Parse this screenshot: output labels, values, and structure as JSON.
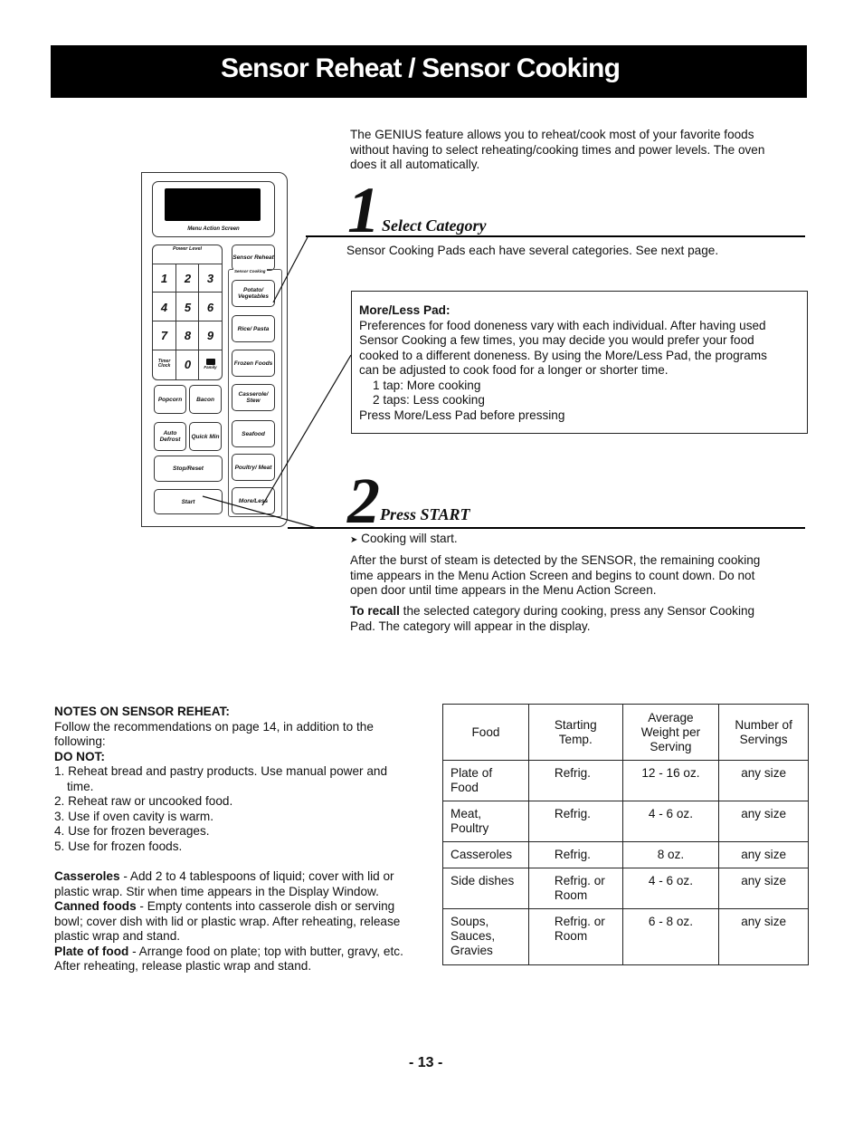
{
  "header": {
    "title": "Sensor Reheat / Sensor Cooking"
  },
  "intro": {
    "lines": [
      "The GENIUS feature allows you to reheat/cook most of your favorite foods",
      "without having to select reheating/cooking times and power levels.  The oven",
      "does it all automatically."
    ]
  },
  "step1": {
    "number": "1",
    "label": "Select Category",
    "text": "Sensor Cooking Pads each have several categories.  See next page."
  },
  "more_less_box": {
    "title": "More/Less Pad:",
    "lines": [
      "Preferences for food doneness vary with each individual.  After having used",
      "Sensor Cooking a few times, you may decide you would prefer your food",
      "cooked to a different doneness.  By using the More/Less Pad, the programs",
      "can be adjusted to cook food for a longer or shorter time."
    ],
    "tap1": "1 tap: More cooking",
    "tap2": "2 taps: Less cooking",
    "footer": "Press More/Less Pad before pressing"
  },
  "step2": {
    "number": "2",
    "label": "Press START",
    "arrow_text": "Cooking will start.",
    "para1_lines": [
      "After the burst of steam is detected by the SENSOR, the remaining cooking",
      "time appears in the Menu Action Screen and begins to count down.  Do not",
      "open door until time appears in the Menu Action Screen."
    ],
    "para2_bold": "To recall",
    "para2_rest_line1": " the selected category during cooking, press any Sensor Cooking",
    "para2_line2": "Pad.  The category will appear in the display."
  },
  "keypad": {
    "screen_label": "Menu Action Screen",
    "power_level_label": "Power Level",
    "digits": [
      "1",
      "2",
      "3",
      "4",
      "5",
      "6",
      "7",
      "8",
      "9"
    ],
    "timer_clock": "Timer Clock",
    "zero": "0",
    "family": "Family",
    "popcorn": "Popcorn",
    "bacon": "Bacon",
    "auto_defrost": "Auto Defrost",
    "quick_min": "Quick Min",
    "stop_reset": "Stop/Reset",
    "start": "Start",
    "sensor_reheat": "Sensor Reheat",
    "sensor_cooking_label": "Sensor Cooking",
    "sensor_pads": [
      "Potato/ Vegetables",
      "Rice/ Pasta",
      "Frozen Foods",
      "Casserole/ Stew",
      "Seafood",
      "Poultry/ Meat"
    ],
    "more_less": "More/Less"
  },
  "notes": {
    "heading": "NOTES ON SENSOR REHEAT:",
    "intro_line1": "Follow the recommendations on page 14, in addition to the",
    "intro_line2": "following:",
    "do_not": "DO NOT:",
    "items": [
      {
        "num": "1.",
        "line1": "Reheat bread and pastry products.  Use manual power and",
        "line2": "time."
      },
      {
        "num": "2.",
        "line1": "Reheat raw or uncooked food."
      },
      {
        "num": "3.",
        "line1": "Use if oven cavity is warm."
      },
      {
        "num": "4.",
        "line1": "Use for frozen beverages."
      },
      {
        "num": "5.",
        "line1": "Use for frozen foods."
      }
    ],
    "casseroles_bold": "Casseroles",
    "casseroles_l1": " - Add 2 to 4 tablespoons of liquid; cover with lid or",
    "casseroles_l2": "plastic wrap.  Stir when time appears in the Display Window.",
    "canned_bold": "Canned foods",
    "canned_l1": " - Empty contents into casserole dish or serving",
    "canned_l2": "bowl; cover dish with lid or plastic wrap.  After reheating, release",
    "canned_l3": "plastic wrap and stand.",
    "plate_bold": "Plate of food",
    "plate_l1": " - Arrange food on plate; top with butter, gravy, etc.",
    "plate_l2": "After reheating, release plastic wrap and stand."
  },
  "table": {
    "headers": [
      "Food",
      "Starting Temp.",
      "Average Weight per Serving",
      "Number of Servings"
    ],
    "header_lines": [
      [
        "Food"
      ],
      [
        "Starting",
        "Temp."
      ],
      [
        "Average",
        "Weight per",
        "Serving"
      ],
      [
        "Number of",
        "Servings"
      ]
    ],
    "rows": [
      {
        "food": [
          "Plate of",
          "Food"
        ],
        "temp": [
          "Refrig."
        ],
        "weight": "12 - 16 oz.",
        "servings": "any size"
      },
      {
        "food": [
          "Meat,",
          "Poultry"
        ],
        "temp": [
          "Refrig."
        ],
        "weight": "4 - 6 oz.",
        "servings": "any size"
      },
      {
        "food": [
          "Casseroles"
        ],
        "temp": [
          "Refrig."
        ],
        "weight": "8 oz.",
        "servings": "any size"
      },
      {
        "food": [
          "Side dishes"
        ],
        "temp": [
          "Refrig. or",
          "Room"
        ],
        "weight": "4 - 6 oz.",
        "servings": "any size"
      },
      {
        "food": [
          "Soups,",
          "Sauces,",
          "Gravies"
        ],
        "temp": [
          "Refrig. or",
          "Room"
        ],
        "weight": "6 - 8 oz.",
        "servings": "any size"
      }
    ]
  },
  "footer": {
    "page_number": "- 13 -"
  }
}
